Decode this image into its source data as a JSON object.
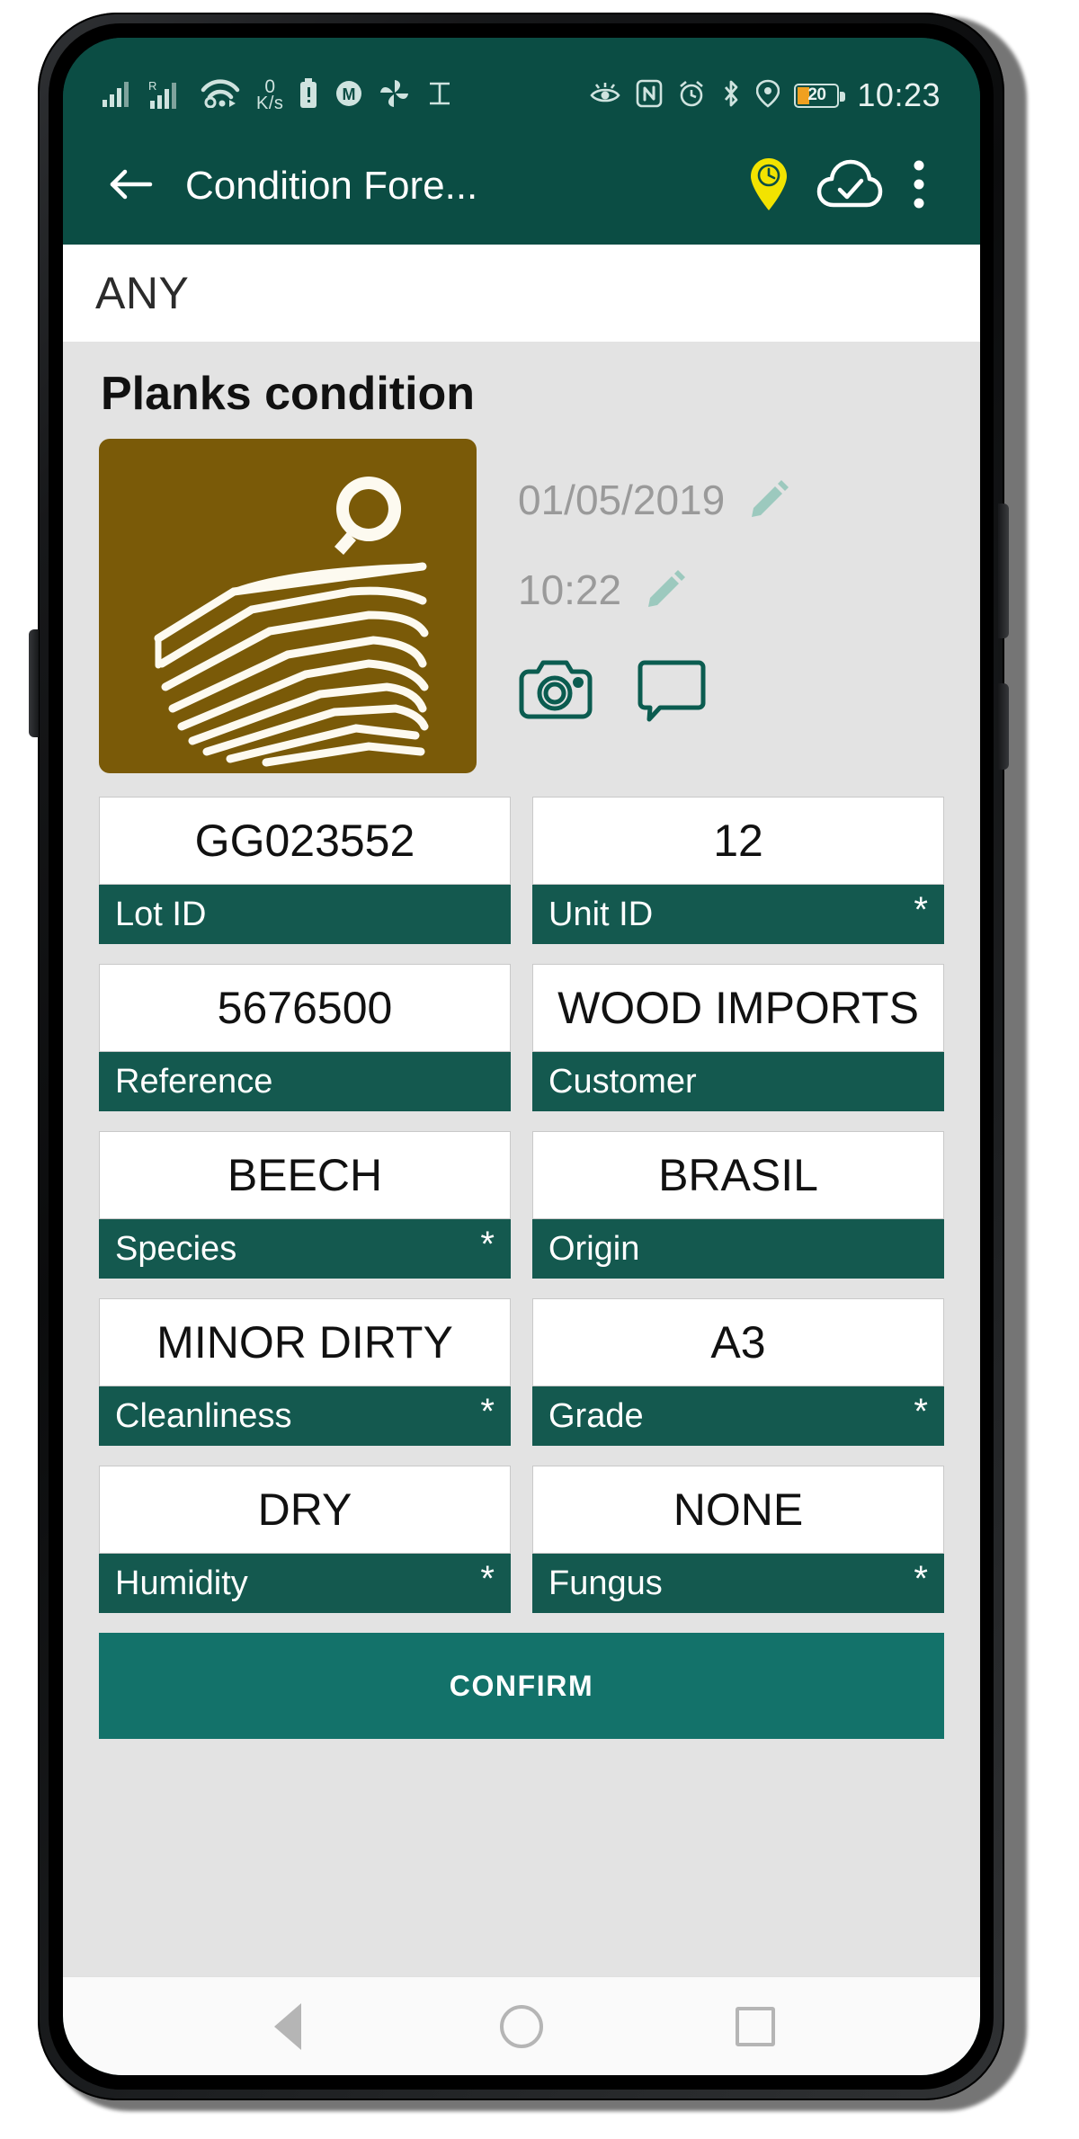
{
  "statusbar": {
    "left_icons": [
      "signal-bars-icon",
      "roaming-signal-icon",
      "wifi-icon",
      "data-rate-icon",
      "battery-alert-icon",
      "m-circle-icon",
      "pinwheel-icon",
      "text-select-icon"
    ],
    "data_rate_value": "0",
    "data_rate_unit": "K/s",
    "right_icons": [
      "eye-comfort-icon",
      "nfc-icon",
      "alarm-icon",
      "bluetooth-icon",
      "location-icon"
    ],
    "battery_level": "20",
    "battery_color": "#f0a020",
    "time": "10:23"
  },
  "appbar": {
    "back_icon": "back-arrow-icon",
    "title": "Condition Fore...",
    "pin_icon": "location-pin-clock-icon",
    "pin_color": "#f2e300",
    "cloud_icon": "cloud-check-icon",
    "menu_icon": "overflow-menu-icon",
    "background_color": "#0b4d44"
  },
  "filter_bar": {
    "value": "ANY"
  },
  "section": {
    "title": "Planks condition",
    "thumbnail_icon": "wood-plank-inspect-icon",
    "thumbnail_color": "#7a5a08",
    "date": "01/05/2019",
    "date_edit_icon": "pencil-edit-icon",
    "time": "10:22",
    "time_edit_icon": "pencil-edit-icon",
    "camera_icon": "camera-icon",
    "comment_icon": "comment-bubble-icon"
  },
  "fields": [
    [
      {
        "value": "GG023552",
        "label": "Lot ID",
        "required": ""
      },
      {
        "value": "12",
        "label": "Unit ID",
        "required": "*"
      }
    ],
    [
      {
        "value": "5676500",
        "label": "Reference",
        "required": ""
      },
      {
        "value": "WOOD IMPORTS",
        "label": "Customer",
        "required": ""
      }
    ],
    [
      {
        "value": "BEECH",
        "label": "Species",
        "required": "*"
      },
      {
        "value": "BRASIL",
        "label": "Origin",
        "required": ""
      }
    ],
    [
      {
        "value": "MINOR DIRTY",
        "label": "Cleanliness",
        "required": "*"
      },
      {
        "value": "A3",
        "label": "Grade",
        "required": "*"
      }
    ],
    [
      {
        "value": "DRY",
        "label": "Humidity",
        "required": "*"
      },
      {
        "value": "NONE",
        "label": "Fungus",
        "required": "*"
      }
    ]
  ],
  "confirm_button": {
    "label": "CONFIRM",
    "color": "#13726a"
  },
  "navbar": {
    "back_icon": "nav-back-triangle-icon",
    "home_icon": "nav-home-circle-icon",
    "recents_icon": "nav-recents-square-icon"
  }
}
